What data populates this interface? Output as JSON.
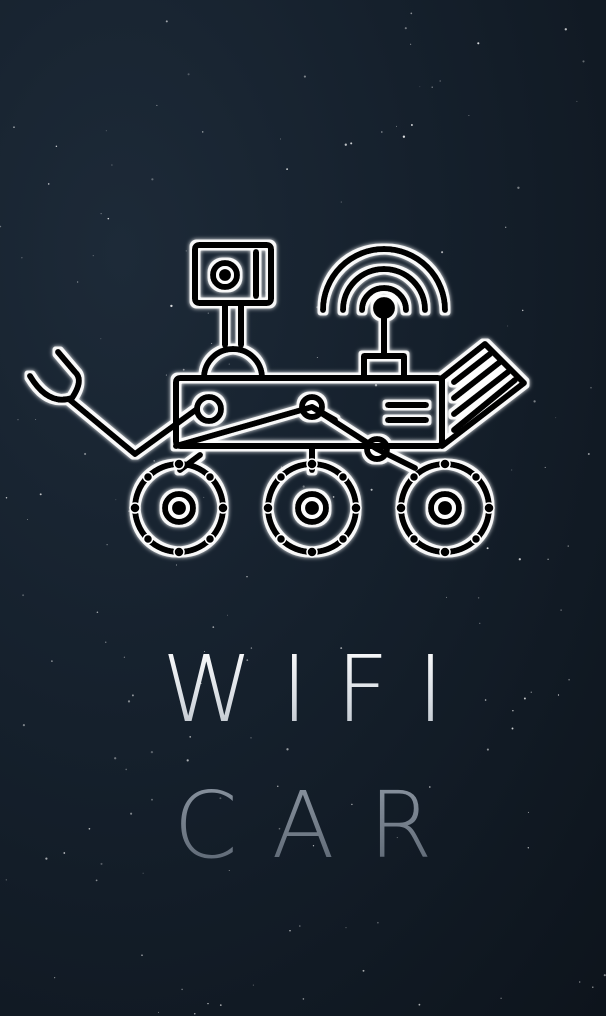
{
  "splash": {
    "logo_icon": "mars-rover-icon",
    "title_line1": "WIFI",
    "title_line2": "CAR"
  },
  "colors": {
    "background_top": "#1d2a38",
    "background_bottom": "#0d141c",
    "icon_stroke": "#000000",
    "icon_glow": "#ffffff",
    "title_line1": "#ffffff",
    "title_line2": "#7d8793"
  }
}
